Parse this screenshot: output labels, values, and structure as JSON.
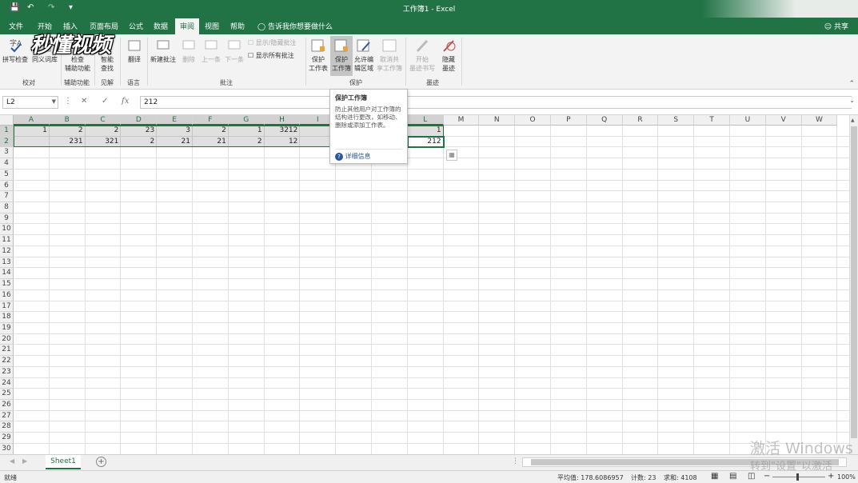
{
  "window": {
    "title": "工作簿1 - Excel"
  },
  "menu": {
    "tabs": [
      "文件",
      "开始",
      "插入",
      "页面布局",
      "公式",
      "数据",
      "审阅",
      "视图",
      "帮助"
    ],
    "active": "审阅",
    "tell_me": "告诉我你想要做什么",
    "share": "共享"
  },
  "logo_text": "秒懂视频",
  "ribbon": {
    "spell_check": "拼写检查",
    "thesaurus": "同义词库",
    "group_proofing": "校对",
    "check_accessibility_1": "检查",
    "check_accessibility_2": "辅助功能",
    "group_accessibility": "辅助功能",
    "smart_lookup_1": "智能",
    "smart_lookup_2": "查找",
    "group_insights": "见解",
    "translate": "翻译",
    "group_language": "语言",
    "new_comment": "新建批注",
    "delete": "删除",
    "previous": "上一条",
    "next": "下一条",
    "show_hide_comment": "显示/隐藏批注",
    "show_all_comments": "显示所有批注",
    "group_comments": "批注",
    "protect_sheet_1": "保护",
    "protect_sheet_2": "工作表",
    "protect_workbook_1": "保护",
    "protect_workbook_2": "工作簿",
    "allow_edit_1": "允许编",
    "allow_edit_2": "辑区域",
    "unshare_1": "取消共",
    "unshare_2": "享工作簿",
    "group_protect": "保护",
    "start_ink_1": "开始",
    "start_ink_2": "墨迹书写",
    "hide_ink_1": "隐藏",
    "hide_ink_2": "墨迹",
    "group_ink": "墨迹"
  },
  "formula_bar": {
    "name_box": "L2",
    "fx": "fx",
    "value": "212"
  },
  "columns": [
    "A",
    "B",
    "C",
    "D",
    "E",
    "F",
    "G",
    "H",
    "I",
    "J",
    "K",
    "L",
    "M",
    "N",
    "O",
    "P",
    "Q",
    "R",
    "S",
    "T",
    "U",
    "V",
    "W"
  ],
  "rows": [
    "1",
    "2",
    "3",
    "4",
    "5",
    "6",
    "7",
    "8",
    "9",
    "10",
    "11",
    "12",
    "13",
    "14",
    "15",
    "16",
    "17",
    "18",
    "19",
    "20",
    "21",
    "22",
    "23",
    "24",
    "25",
    "26",
    "27",
    "28",
    "29",
    "30"
  ],
  "cells": {
    "r1": [
      "1",
      "2",
      "2",
      "23",
      "3",
      "2",
      "1",
      "3212",
      "",
      "",
      "",
      "1"
    ],
    "r2": [
      "",
      "231",
      "321",
      "2",
      "21",
      "21",
      "2",
      "12",
      "1",
      "",
      "",
      "212"
    ]
  },
  "tooltip": {
    "title": "保护工作簿",
    "body": "防止其他用户对工作簿的结构进行更改，如移动、删除或添加工作表。",
    "link": "详细信息"
  },
  "sheet_tab": "Sheet1",
  "status": {
    "ready": "就绪",
    "average": "平均值: 178.6086957",
    "count": "计数: 23",
    "sum": "求和: 4108",
    "zoom": "100%"
  },
  "watermark": {
    "line1": "激活 Windows",
    "line2": "转到\"设置\"以激活"
  },
  "colors": {
    "accent": "#217346"
  }
}
